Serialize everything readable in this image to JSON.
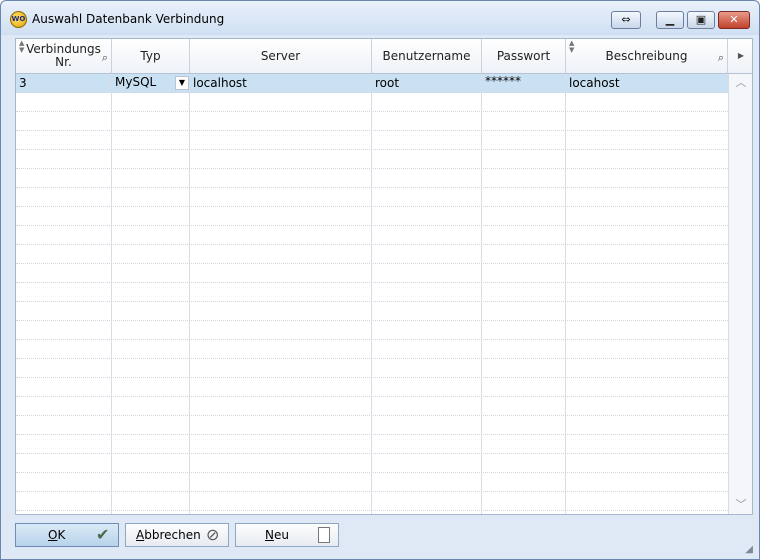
{
  "window": {
    "title": "Auswahl Datenbank Verbindung",
    "app_icon_text": "WO"
  },
  "grid": {
    "columns": [
      {
        "label": "Verbindungs Nr.",
        "line1": "Verbindungs",
        "line2": "Nr."
      },
      {
        "label": "Typ"
      },
      {
        "label": "Server"
      },
      {
        "label": "Benutzername"
      },
      {
        "label": "Passwort"
      },
      {
        "label": "Beschreibung"
      }
    ],
    "rows": [
      {
        "nr": "3",
        "typ": "MySQL",
        "server": "localhost",
        "benutzer": "root",
        "passwort": "******",
        "beschreibung": "locahost"
      }
    ]
  },
  "buttons": {
    "ok": "OK",
    "ok_mnemonic": "O",
    "ok_rest": "K",
    "cancel": "Abbrechen",
    "cancel_mnemonic": "A",
    "cancel_rest": "bbrechen",
    "new": "Neu",
    "new_mnemonic": "N",
    "new_rest": "eu"
  },
  "icons": {
    "ok": "checkmark-icon",
    "cancel": "no-entry-icon",
    "new": "blank-page-icon"
  },
  "colors": {
    "selection": "#c9e1f2",
    "window_bg": "#dfe9f5",
    "close_button": "#c2422c"
  }
}
